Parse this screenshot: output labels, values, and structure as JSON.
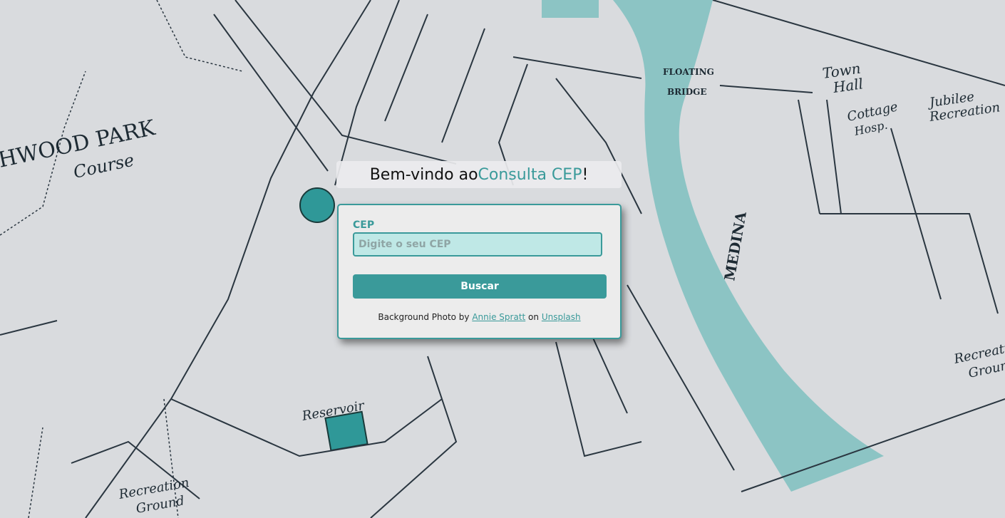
{
  "welcome": {
    "prefix": "Bem-vindo ao ",
    "brand": "Consulta CEP",
    "suffix": "!"
  },
  "form": {
    "label": "CEP",
    "placeholder": "Digite o seu CEP",
    "value": "",
    "button_label": "Buscar"
  },
  "credit": {
    "prefix": "Background Photo by ",
    "author": "Annie Spratt",
    "middle": " on ",
    "site": "Unsplash"
  },
  "map_labels": {
    "park": "HWOOD PARK",
    "course": "Course",
    "reservoir": "Reservoir",
    "recreation_ground": "Recreation Ground",
    "medina": "MEDINA",
    "floating_bridge": "FLOATING BRIDGE",
    "town_hall": "Town Hall",
    "jubilee": "Jubilee Recreation",
    "cottage_hosp": "Cottage Hosp."
  },
  "colors": {
    "accent": "#3a9a9a",
    "water": "#8cc4c4",
    "input_bg": "#bfe8e6"
  }
}
